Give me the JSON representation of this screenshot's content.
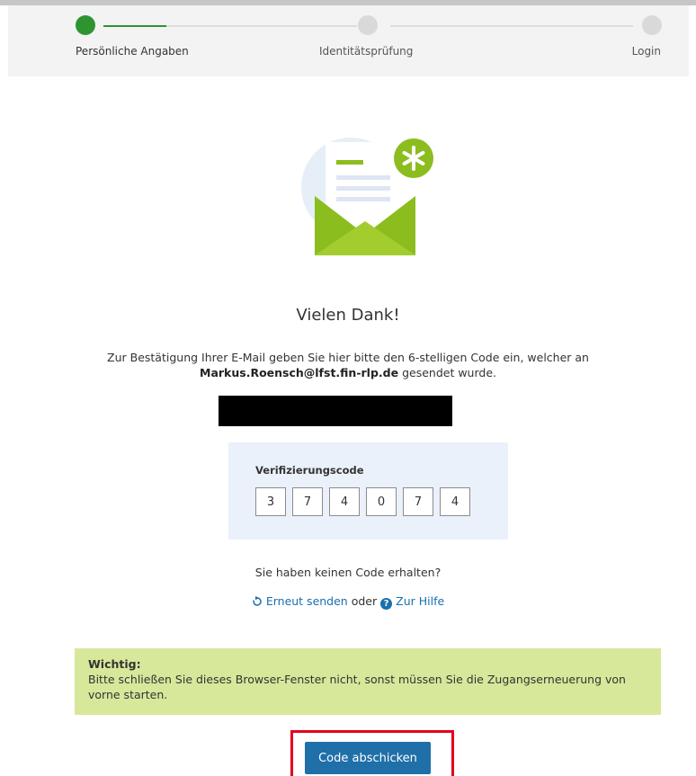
{
  "stepper": {
    "steps": [
      {
        "label": "Persönliche Angaben"
      },
      {
        "label": "Identitätsprüfung"
      },
      {
        "label": "Login"
      }
    ]
  },
  "colors": {
    "accent_green": "#2e9432",
    "button_blue": "#1f6fa8",
    "link_blue": "#1a6faf",
    "notice_bg": "#d7e89b",
    "highlight_red": "#e3001b"
  },
  "main": {
    "title": "Vielen Dank!",
    "instruction_pre": "Zur Bestätigung Ihrer E-Mail geben Sie hier bitte den 6-stelligen Code ein, welcher an",
    "email": "Markus.Roensch@lfst.fin-rlp.de",
    "instruction_post": "gesendet wurde."
  },
  "code": {
    "label": "Verifizierungscode",
    "digits": [
      "3",
      "7",
      "4",
      "0",
      "7",
      "4"
    ]
  },
  "resend": {
    "no_code_text": "Sie haben keinen Code erhalten?",
    "resend_link": "Erneut senden",
    "or_text": "oder",
    "help_link": "Zur Hilfe"
  },
  "notice": {
    "title": "Wichtig:",
    "text": "Bitte schließen Sie dieses Browser-Fenster nicht, sonst müssen Sie die Zugangserneuerung von vorne starten."
  },
  "submit_label": "Code abschicken"
}
